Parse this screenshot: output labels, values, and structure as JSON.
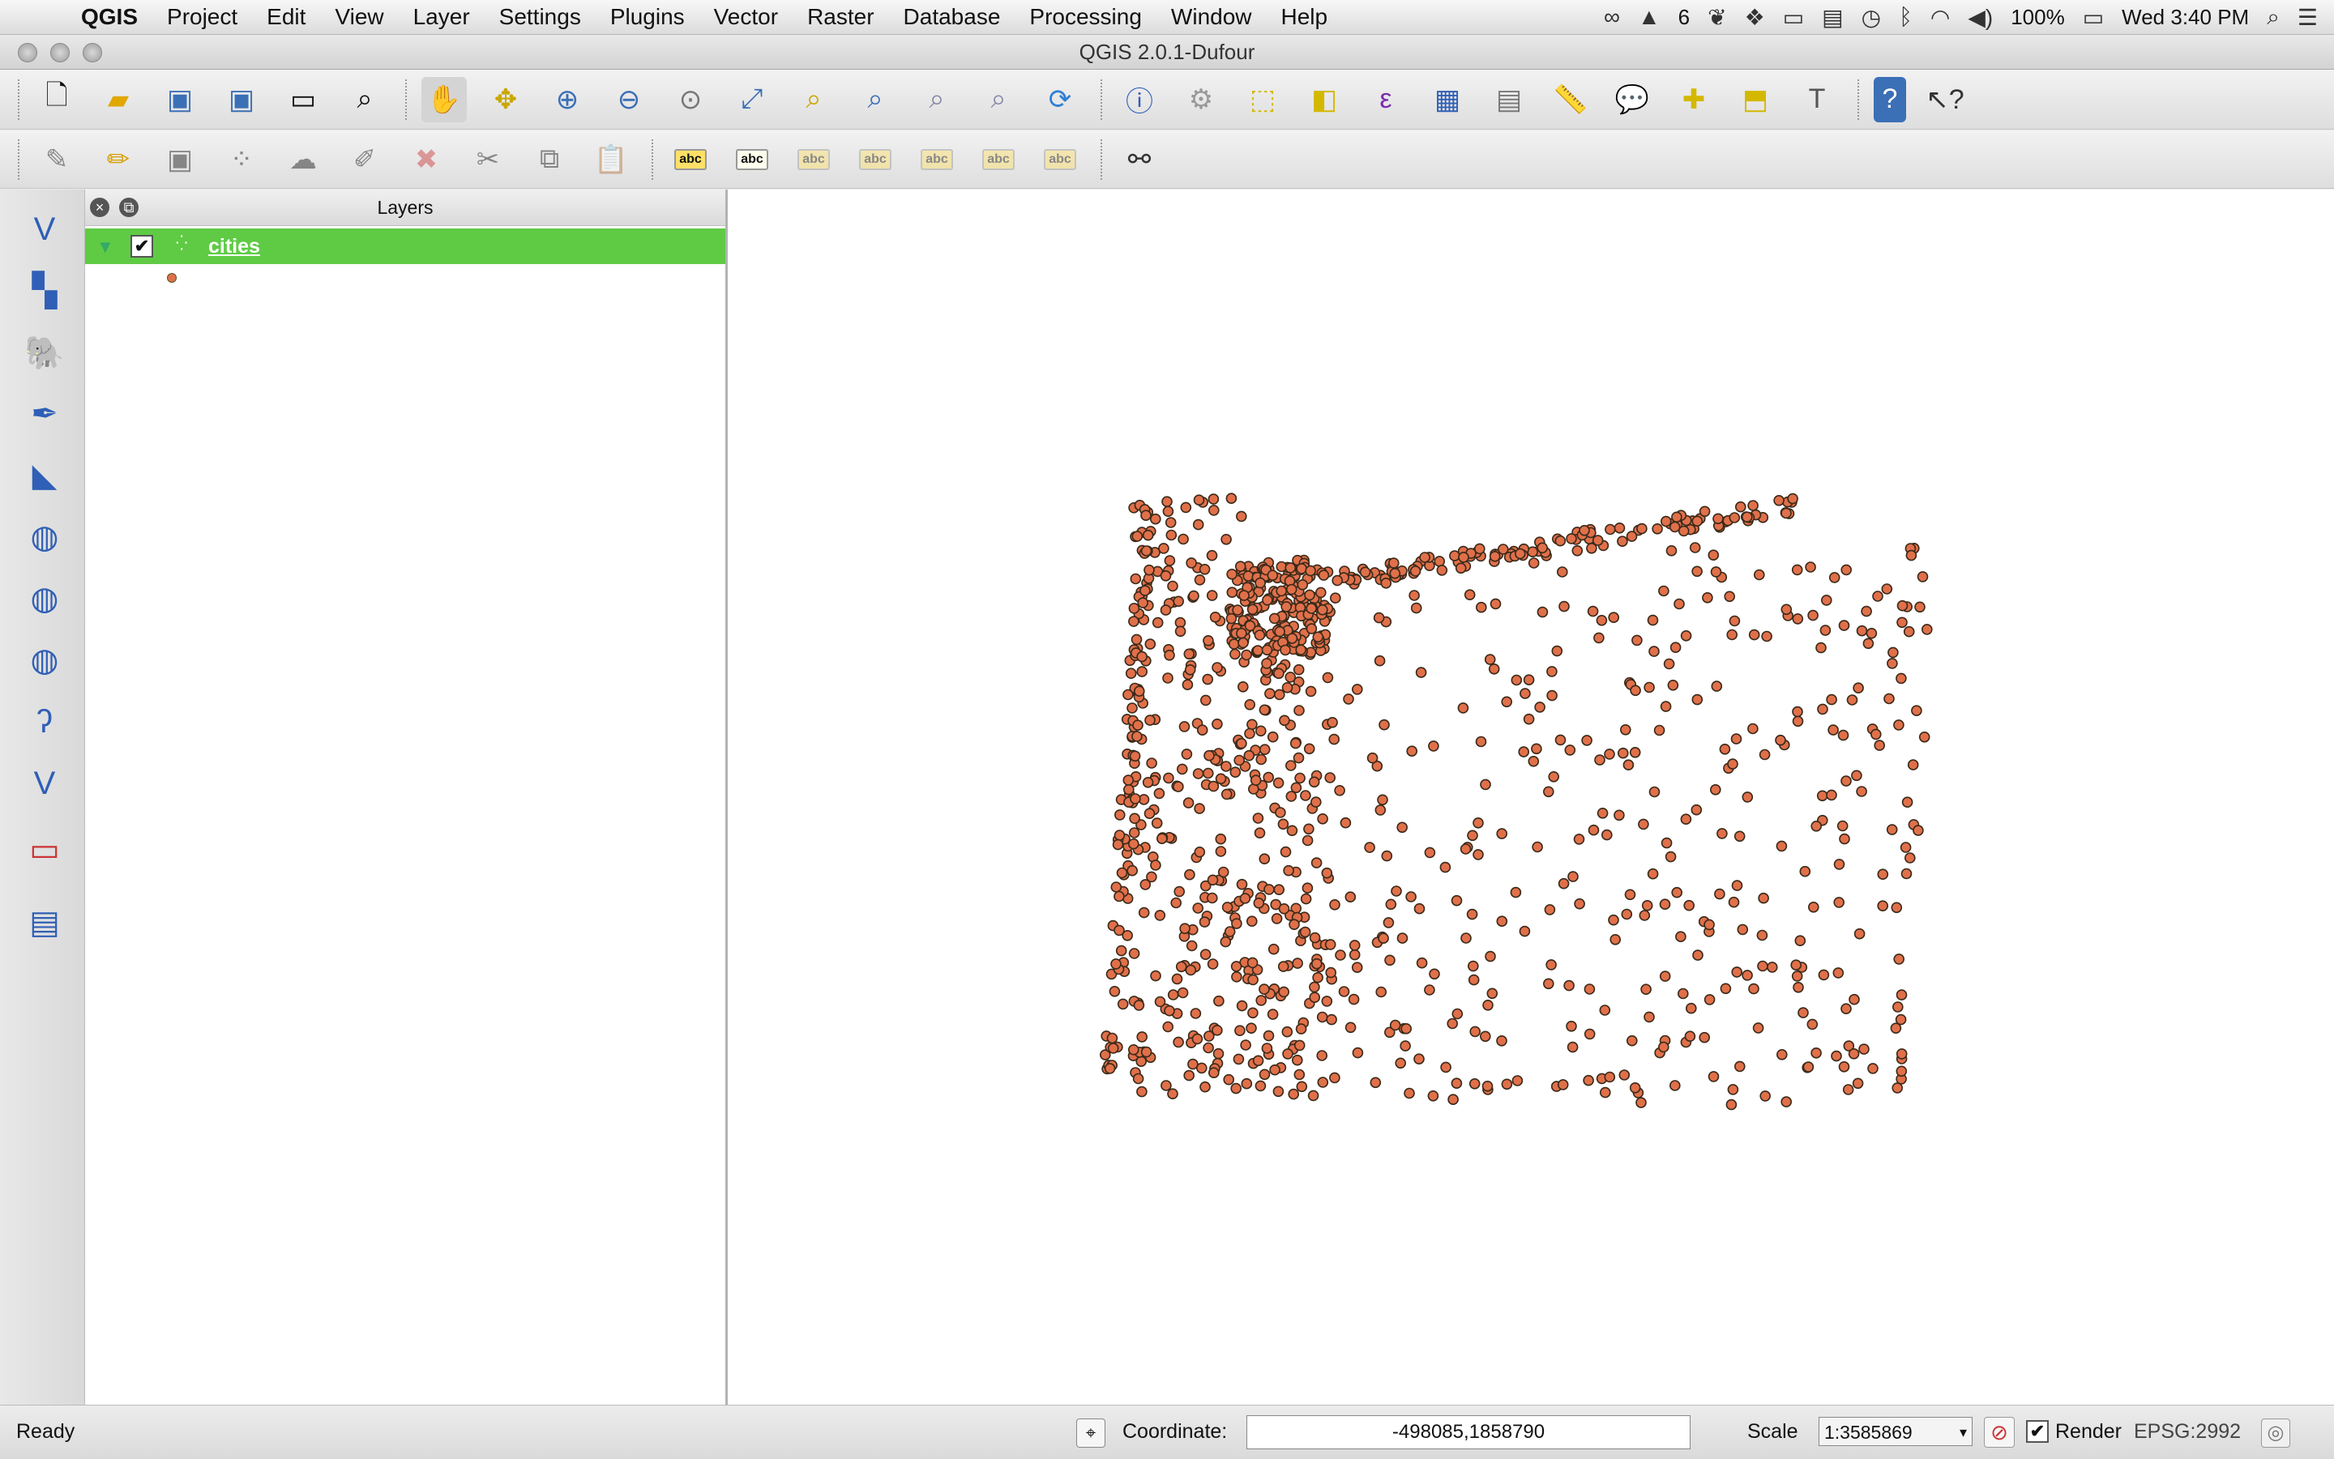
{
  "menubar": {
    "app": "QGIS",
    "menus": [
      "Project",
      "Edit",
      "View",
      "Layer",
      "Settings",
      "Plugins",
      "Vector",
      "Raster",
      "Database",
      "Processing",
      "Window",
      "Help"
    ],
    "tray": {
      "badge": "6",
      "battery": "100%",
      "clock": "Wed 3:40 PM"
    }
  },
  "window": {
    "title": "QGIS 2.0.1-Dufour"
  },
  "toolbar1": {
    "icons": [
      "new-project-icon",
      "open-project-icon",
      "save-project-icon",
      "save-as-icon",
      "new-print-composer-icon",
      "composer-manager-icon",
      "pan-icon",
      "pan-to-selection-icon",
      "zoom-in-icon",
      "zoom-out-icon",
      "zoom-native-icon",
      "zoom-full-icon",
      "zoom-layer-icon",
      "zoom-selection-icon",
      "zoom-last-icon",
      "zoom-next-icon",
      "refresh-icon",
      "identify-icon",
      "action-icon",
      "select-features-icon",
      "deselect-icon",
      "select-by-expression-icon",
      "attribute-table-icon",
      "statistics-icon",
      "measure-icon",
      "map-tips-icon",
      "new-bookmark-icon",
      "show-bookmarks-icon",
      "text-annotation-icon",
      "help-icon",
      "whats-this-icon"
    ]
  },
  "toolbar2": {
    "icons": [
      "current-edits-icon",
      "toggle-editing-icon",
      "save-edits-icon",
      "add-feature-icon",
      "move-feature-icon",
      "node-tool-icon",
      "delete-selected-icon",
      "cut-features-icon",
      "copy-features-icon",
      "paste-features-icon",
      "label-icon",
      "label-pin-icon",
      "label-highlight-icon",
      "label-show-hide-icon",
      "label-move-icon",
      "label-rotate-icon",
      "label-change-icon",
      "gps-binoculars-icon"
    ],
    "label_text": "abc"
  },
  "lefttb": {
    "icons": [
      "add-vector-layer-icon",
      "add-raster-layer-icon",
      "add-postgis-layer-icon",
      "add-spatialite-layer-icon",
      "add-mssql-layer-icon",
      "add-wms-layer-icon",
      "add-wcs-layer-icon",
      "add-wfs-layer-icon",
      "add-delimited-text-icon",
      "new-shapefile-icon",
      "remove-layer-icon",
      "composer-icon"
    ]
  },
  "layers_panel": {
    "title": "Layers",
    "layers": [
      {
        "name": "cities",
        "checked": true,
        "symbol_color": "#e0704a"
      }
    ]
  },
  "map": {
    "point_color": "#e0704a",
    "point_outline": "#3a2a1a"
  },
  "statusbar": {
    "status": "Ready",
    "coordinate_label": "Coordinate:",
    "coordinate_value": "-498085,1858790",
    "scale_label": "Scale",
    "scale_value": "1:3585869",
    "render_label": "Render",
    "render_checked": true,
    "crs": "EPSG:2992"
  },
  "colors": {
    "selection_green": "#5fcb45"
  }
}
